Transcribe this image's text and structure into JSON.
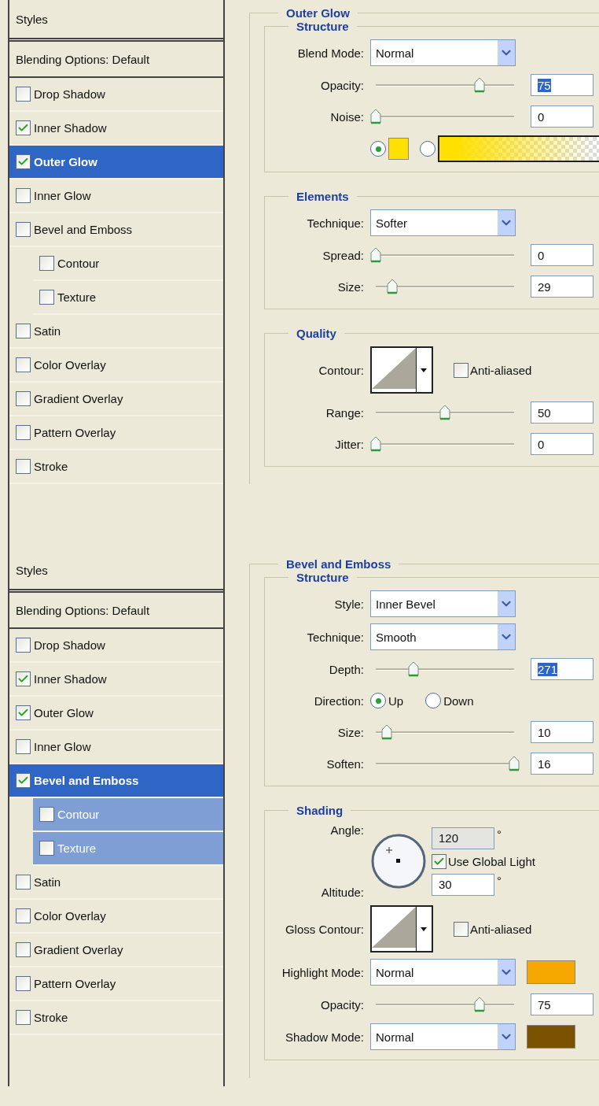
{
  "panels": [
    {
      "sidebar": {
        "header": "Styles",
        "blending": "Blending Options: Default",
        "items": [
          {
            "label": "Drop Shadow",
            "kind": "effect",
            "checked": false,
            "selected": false,
            "highlighted": false
          },
          {
            "label": "Inner Shadow",
            "kind": "effect",
            "checked": true,
            "selected": false,
            "highlighted": false
          },
          {
            "label": "Outer Glow",
            "kind": "effect",
            "checked": true,
            "selected": true,
            "highlighted": false
          },
          {
            "label": "Inner Glow",
            "kind": "effect",
            "checked": false,
            "selected": false,
            "highlighted": false
          },
          {
            "label": "Bevel and Emboss",
            "kind": "effect",
            "checked": false,
            "selected": false,
            "highlighted": false
          },
          {
            "label": "Contour",
            "kind": "sub",
            "checked": false,
            "selected": false,
            "highlighted": false
          },
          {
            "label": "Texture",
            "kind": "sub",
            "checked": false,
            "selected": false,
            "highlighted": false
          },
          {
            "label": "Satin",
            "kind": "effect",
            "checked": false,
            "selected": false,
            "highlighted": false
          },
          {
            "label": "Color Overlay",
            "kind": "effect",
            "checked": false,
            "selected": false,
            "highlighted": false
          },
          {
            "label": "Gradient Overlay",
            "kind": "effect",
            "checked": false,
            "selected": false,
            "highlighted": false
          },
          {
            "label": "Pattern Overlay",
            "kind": "effect",
            "checked": false,
            "selected": false,
            "highlighted": false
          },
          {
            "label": "Stroke",
            "kind": "effect",
            "checked": false,
            "selected": false,
            "highlighted": false
          }
        ]
      },
      "effect": {
        "title": "Outer Glow",
        "groups": [
          {
            "title": "Structure",
            "rows": [
              {
                "kind": "select",
                "label": "Blend Mode:",
                "value": "Normal"
              },
              {
                "kind": "slider",
                "label": "Opacity:",
                "level": 0.75,
                "value": "75",
                "highlighted": true
              },
              {
                "kind": "slider",
                "label": "Noise:",
                "level": 0,
                "value": "0",
                "highlighted": false
              },
              {
                "kind": "fill",
                "options": [
                  {
                    "kind": "solid",
                    "selected": true,
                    "color": "#ffe000"
                  },
                  {
                    "kind": "gradient",
                    "selected": false,
                    "color": "#ffe000"
                  }
                ]
              }
            ]
          },
          {
            "title": "Elements",
            "rows": [
              {
                "kind": "select",
                "label": "Technique:",
                "value": "Softer"
              },
              {
                "kind": "slider",
                "label": "Spread:",
                "level": 0,
                "value": "0",
                "highlighted": false
              },
              {
                "kind": "slider",
                "label": "Size:",
                "level": 0.12,
                "value": "29",
                "highlighted": false
              }
            ]
          },
          {
            "title": "Quality",
            "rows": [
              {
                "kind": "contour",
                "label": "Contour:",
                "antialiased": {
                  "label": "Anti-aliased",
                  "checked": false
                }
              },
              {
                "kind": "slider",
                "label": "Range:",
                "level": 0.5,
                "value": "50",
                "highlighted": false
              },
              {
                "kind": "slider",
                "label": "Jitter:",
                "level": 0,
                "value": "0",
                "highlighted": false
              }
            ]
          }
        ]
      }
    },
    {
      "sidebar": {
        "header": "Styles",
        "blending": "Blending Options: Default",
        "items": [
          {
            "label": "Drop Shadow",
            "kind": "effect",
            "checked": false,
            "selected": false,
            "highlighted": false
          },
          {
            "label": "Inner Shadow",
            "kind": "effect",
            "checked": true,
            "selected": false,
            "highlighted": false
          },
          {
            "label": "Outer Glow",
            "kind": "effect",
            "checked": true,
            "selected": false,
            "highlighted": false
          },
          {
            "label": "Inner Glow",
            "kind": "effect",
            "checked": false,
            "selected": false,
            "highlighted": false
          },
          {
            "label": "Bevel and Emboss",
            "kind": "effect",
            "checked": true,
            "selected": true,
            "highlighted": false
          },
          {
            "label": "Contour",
            "kind": "sub",
            "checked": false,
            "selected": false,
            "highlighted": true
          },
          {
            "label": "Texture",
            "kind": "sub",
            "checked": false,
            "selected": false,
            "highlighted": true
          },
          {
            "label": "Satin",
            "kind": "effect",
            "checked": false,
            "selected": false,
            "highlighted": false
          },
          {
            "label": "Color Overlay",
            "kind": "effect",
            "checked": false,
            "selected": false,
            "highlighted": false
          },
          {
            "label": "Gradient Overlay",
            "kind": "effect",
            "checked": false,
            "selected": false,
            "highlighted": false
          },
          {
            "label": "Pattern Overlay",
            "kind": "effect",
            "checked": false,
            "selected": false,
            "highlighted": false
          },
          {
            "label": "Stroke",
            "kind": "effect",
            "checked": false,
            "selected": false,
            "highlighted": false
          }
        ]
      },
      "effect": {
        "title": "Bevel and Emboss",
        "groups": [
          {
            "title": "Structure",
            "rows": [
              {
                "kind": "select",
                "label": "Style:",
                "value": "Inner Bevel"
              },
              {
                "kind": "select",
                "label": "Technique:",
                "value": "Smooth"
              },
              {
                "kind": "slider",
                "label": "Depth:",
                "level": 0.27,
                "value": "271",
                "highlighted": true
              },
              {
                "kind": "radio",
                "label": "Direction:",
                "options": [
                  {
                    "label": "Up",
                    "selected": true
                  },
                  {
                    "label": "Down",
                    "selected": false
                  }
                ]
              },
              {
                "kind": "slider",
                "label": "Size:",
                "level": 0.08,
                "value": "10",
                "highlighted": false
              },
              {
                "kind": "slider",
                "label": "Soften:",
                "level": 1,
                "value": "16",
                "highlighted": false
              }
            ]
          },
          {
            "title": "Shading",
            "rows": [
              {
                "kind": "angle",
                "label": "Angle:",
                "value": "120",
                "unit": "°",
                "global_light": {
                  "label": "Use Global Light",
                  "checked": true
                },
                "altitude": {
                  "label": "Altitude:",
                  "value": "30",
                  "unit": "°"
                }
              },
              {
                "kind": "contour",
                "label": "Gloss Contour:",
                "antialiased": {
                  "label": "Anti-aliased",
                  "checked": false
                }
              },
              {
                "kind": "select",
                "label": "Highlight Mode:",
                "value": "Normal",
                "color": "#f6a800"
              },
              {
                "kind": "slider",
                "label": "Opacity:",
                "level": 0.75,
                "value": "75",
                "highlighted": false
              },
              {
                "kind": "select",
                "label": "Shadow Mode:",
                "value": "Normal",
                "color": "#7a5200"
              }
            ]
          }
        ]
      }
    }
  ]
}
